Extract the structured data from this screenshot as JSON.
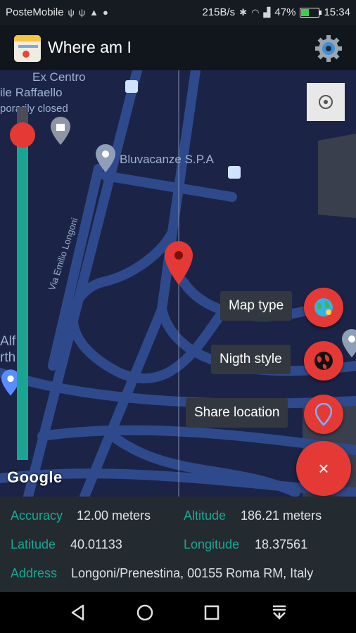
{
  "status_bar": {
    "carrier": "PosteMobile",
    "net_speed": "215B/s",
    "battery": "47%",
    "battery_level": 0.47,
    "time": "15:34"
  },
  "app_bar": {
    "title": "Where am I",
    "settings_icon": "gear-icon",
    "logo_icon": "map-app-icon"
  },
  "map": {
    "labels": [
      "Ex Centro",
      "ile Raffaello",
      "porarily closed",
      "Bluvacanze S.P.A",
      "Via Emilio Longoni",
      "Alf",
      "rth"
    ],
    "attribution": "Google",
    "zoom_level": 0.92
  },
  "fab_menu": {
    "items": [
      {
        "label": "Map type",
        "icon": "globe-icon"
      },
      {
        "label": "Nigth style",
        "icon": "dark-globe-icon"
      },
      {
        "label": "Share location",
        "icon": "location-pin-icon"
      }
    ],
    "close_label": "×"
  },
  "info": {
    "accuracy_label": "Accuracy",
    "accuracy_value": "12.00 meters",
    "altitude_label": "Altitude",
    "altitude_value": "186.21 meters",
    "latitude_label": "Latitude",
    "latitude_value": "40.01133",
    "longitude_label": "Longitude",
    "longitude_value": "18.37561",
    "address_label": "Address",
    "address_value": "Longoni/Prenestina, 00155 Roma RM, Italy"
  },
  "colors": {
    "accent": "#e53935",
    "teal": "#1aa590",
    "map_bg": "#1b2447",
    "road": "#2f4a8c"
  }
}
